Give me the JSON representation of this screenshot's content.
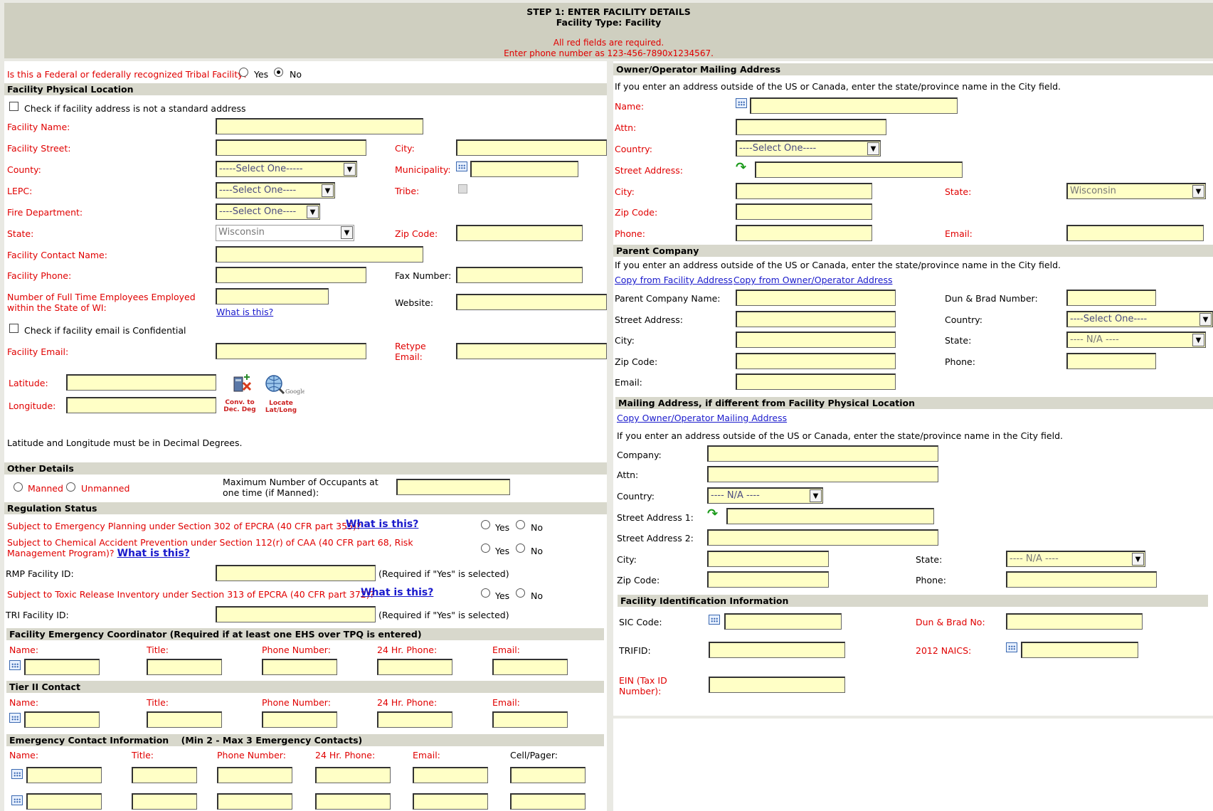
{
  "header": {
    "title": "STEP 1: ENTER FACILITY DETAILS",
    "facility_type": "Facility Type: Facility",
    "required_note": "All red fields are required.",
    "phone_note": "Enter phone number as 123-456-7890x1234567."
  },
  "left": {
    "tribal_question": "Is this a Federal or federally recognized Tribal Facility?",
    "yes": "Yes",
    "no": "No",
    "physical_location_title": "Facility Physical Location",
    "nonstandard_address": "Check if facility address is not a standard address",
    "facility_name": "Facility Name:",
    "facility_street": "Facility Street:",
    "city": "City:",
    "county": "County:",
    "county_select": "-----Select One-----",
    "municipality": "Municipality:",
    "lepc": "LEPC:",
    "lepc_select": "----Select One----",
    "tribe": "Tribe:",
    "fire_department": "Fire Department:",
    "fire_select": "----Select One----",
    "state": "State:",
    "state_value": "Wisconsin",
    "zip_code": "Zip Code:",
    "contact_name": "Facility Contact Name:",
    "facility_phone": "Facility Phone:",
    "fax_number": "Fax Number:",
    "employees": "Number of Full Time Employees Employed within the State of WI:",
    "what_is_this": "What is this?",
    "website": "Website:",
    "email_confidential": "Check if facility email is Confidential",
    "facility_email": "Facility Email:",
    "retype_email": "Retype Email:",
    "latitude": "Latitude:",
    "longitude": "Longitude:",
    "conv_label": "Conv. to Dec. Deg",
    "locate_label": "Locate Lat/Long",
    "latlong_note": "Latitude and Longitude must be in Decimal Degrees.",
    "other_details_title": "Other Details",
    "manned": "Manned",
    "unmanned": "Unmanned",
    "max_occupants": "Maximum Number of Occupants at one time (if Manned):",
    "regulation_title": "Regulation Status",
    "reg1": "Subject to Emergency Planning under Section 302 of EPCRA (40 CFR part 355)?",
    "reg2": "Subject to Chemical Accident Prevention under Section 112(r) of CAA (40 CFR part 68, Risk Management Program)?",
    "rmp_id": "RMP Facility ID:",
    "required_if_yes": "(Required if \"Yes\" is selected)",
    "reg3": "Subject to Toxic Release Inventory under Section 313 of EPCRA (40 CFR part 372)?",
    "tri_id": "TRI Facility ID:",
    "fec_title": "Facility Emergency Coordinator (Required if at least one EHS over TPQ is entered)",
    "name": "Name:",
    "title": "Title:",
    "phone_number": "Phone Number:",
    "hr24_phone": "24 Hr. Phone:",
    "email": "Email:",
    "tier2_title": "Tier II Contact",
    "emergency_title": "Emergency Contact Information    (Min 2 - Max 3 Emergency Contacts)",
    "cell_pager": "Cell/Pager:"
  },
  "right": {
    "owner_title": "Owner/Operator Mailing Address",
    "outside_note": "If you enter an address outside of the US or Canada, enter the state/province name in the City field.",
    "name": "Name:",
    "attn": "Attn:",
    "country": "Country:",
    "country_select": "----Select One----",
    "street_address": "Street Address:",
    "city": "City:",
    "state": "State:",
    "state_value": "Wisconsin",
    "zip_code": "Zip Code:",
    "phone": "Phone:",
    "email": "Email:",
    "parent_title": "Parent Company",
    "copy_facility": "Copy from Facility Address",
    "copy_owner": "Copy from Owner/Operator Address",
    "parent_name": "Parent Company Name:",
    "dun_brad_number": "Dun & Brad Number:",
    "na_select": "---- N/A ----",
    "mailing_title": "Mailing Address, if different from Facility Physical Location",
    "copy_owner_mailing": "Copy Owner/Operator Mailing Address",
    "company": "Company:",
    "street1": "Street Address 1:",
    "street2": "Street Address 2:",
    "fid_title": "Facility Identification Information",
    "sic_code": "SIC Code:",
    "dun_brad_no": "Dun & Brad No:",
    "trifid": "TRIFID:",
    "naics": "2012 NAICS:",
    "ein": "EIN (Tax ID Number):"
  }
}
